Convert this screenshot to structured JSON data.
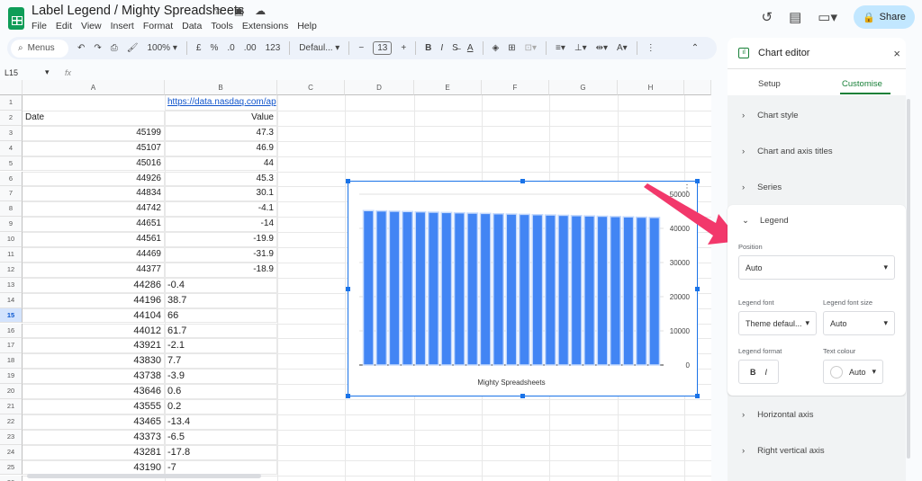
{
  "app": {
    "title": "Label Legend / Mighty Spreadsheets",
    "menu": [
      "File",
      "Edit",
      "View",
      "Insert",
      "Format",
      "Data",
      "Tools",
      "Extensions",
      "Help"
    ],
    "share": "Share"
  },
  "toolbar": {
    "search": "Menus",
    "zoom": "100%",
    "currency": "£",
    "percent": "%",
    "dec_less": ".0",
    "dec_more": ".00",
    "number_format": "123",
    "font": "Defaul...",
    "font_size": "13",
    "bold": "B",
    "italic": "I"
  },
  "formula_bar": {
    "cell_ref": "L15",
    "fx": "fx"
  },
  "sheet": {
    "columns": [
      "A",
      "B",
      "C",
      "D",
      "E",
      "F",
      "G",
      "H"
    ],
    "link": "https://data.nasdaq.com/ap",
    "header": {
      "a": "Date",
      "b": "Value"
    },
    "rows": [
      [
        "45199",
        "47.3"
      ],
      [
        "45107",
        "46.9"
      ],
      [
        "45016",
        "44"
      ],
      [
        "44926",
        "45.3"
      ],
      [
        "44834",
        "30.1"
      ],
      [
        "44742",
        "-4.1"
      ],
      [
        "44651",
        "-14"
      ],
      [
        "44561",
        "-19.9"
      ],
      [
        "44469",
        "-31.9"
      ],
      [
        "44377",
        "-18.9"
      ],
      [
        "44286",
        "-0.4"
      ],
      [
        "44196",
        "38.7"
      ],
      [
        "44104",
        "66"
      ],
      [
        "44012",
        "61.7"
      ],
      [
        "43921",
        "-2.1"
      ],
      [
        "43830",
        "7.7"
      ],
      [
        "43738",
        "-3.9"
      ],
      [
        "43646",
        "0.6"
      ],
      [
        "43555",
        "0.2"
      ],
      [
        "43465",
        "-13.4"
      ],
      [
        "43373",
        "-6.5"
      ],
      [
        "43281",
        "-17.8"
      ],
      [
        "43190",
        "-7"
      ]
    ],
    "selected_row": "15"
  },
  "chart_data": {
    "type": "bar",
    "title": "Mighty Spreadsheets",
    "values": [
      45199,
      45107,
      45016,
      44926,
      44834,
      44742,
      44651,
      44561,
      44469,
      44377,
      44286,
      44196,
      44104,
      44012,
      43921,
      43830,
      43738,
      43646,
      43555,
      43465,
      43373,
      43281,
      43190
    ],
    "ylim": [
      0,
      50000
    ],
    "yticks": [
      "0",
      "10000",
      "20000",
      "30000",
      "40000",
      "50000"
    ],
    "y_axis_side": "right",
    "grid": true,
    "color": "#4285f4"
  },
  "editor": {
    "title": "Chart editor",
    "tabs": [
      "Setup",
      "Customise"
    ],
    "active_tab": "Customise",
    "sections_top": [
      "Chart style",
      "Chart and axis titles",
      "Series"
    ],
    "legend": {
      "title": "Legend",
      "position_label": "Position",
      "position": "Auto",
      "font_label": "Legend font",
      "font": "Theme defaul...",
      "size_label": "Legend font size",
      "size": "Auto",
      "format_label": "Legend format",
      "bold": "B",
      "italic": "I",
      "colour_label": "Text colour",
      "colour": "Auto"
    },
    "sections_bottom": [
      "Horizontal axis",
      "Right vertical axis"
    ]
  },
  "colors": {
    "accent": "#188038",
    "arrow": "#f2386b"
  }
}
